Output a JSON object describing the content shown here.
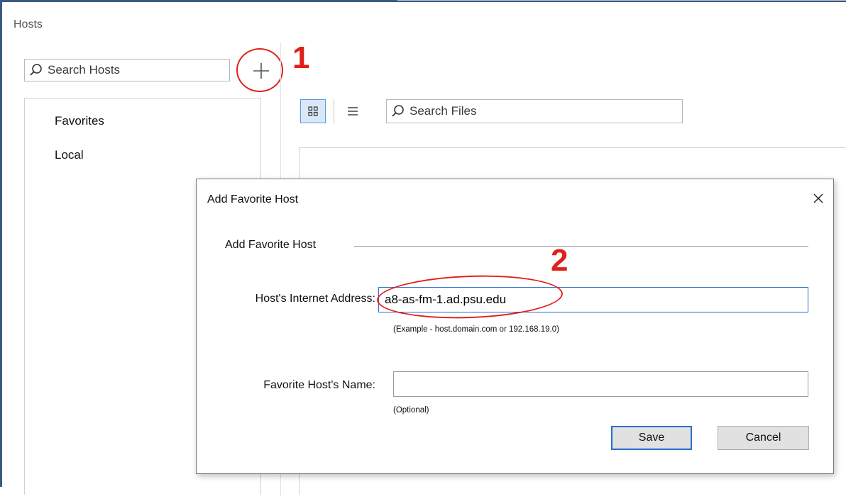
{
  "panel": {
    "title": "Hosts",
    "search_placeholder": "Search Hosts",
    "add_label": "+",
    "nav": [
      "Favorites",
      "Local"
    ]
  },
  "files": {
    "search_placeholder": "Search Files"
  },
  "annotations": {
    "marker_1": "1",
    "marker_2": "2",
    "color": "#e0201a"
  },
  "dialog": {
    "title": "Add Favorite Host",
    "close_label": "✕",
    "group_title": "Add Favorite Host",
    "address_label": "Host's Internet Address:",
    "address_value": "a8-as-fm-1.ad.psu.edu",
    "address_hint": "(Example - host.domain.com or 192.168.19.0)",
    "name_label": "Favorite Host's Name:",
    "name_value": "",
    "name_hint": "(Optional)",
    "save_label": "Save",
    "cancel_label": "Cancel"
  },
  "icons": {
    "search": "search-icon",
    "add": "plus-icon",
    "grid_view": "grid-view-icon",
    "list_view": "list-view-icon",
    "close": "close-icon"
  },
  "colors": {
    "accent": "#2a6ec9",
    "selected_bg": "#d8e8f8"
  }
}
